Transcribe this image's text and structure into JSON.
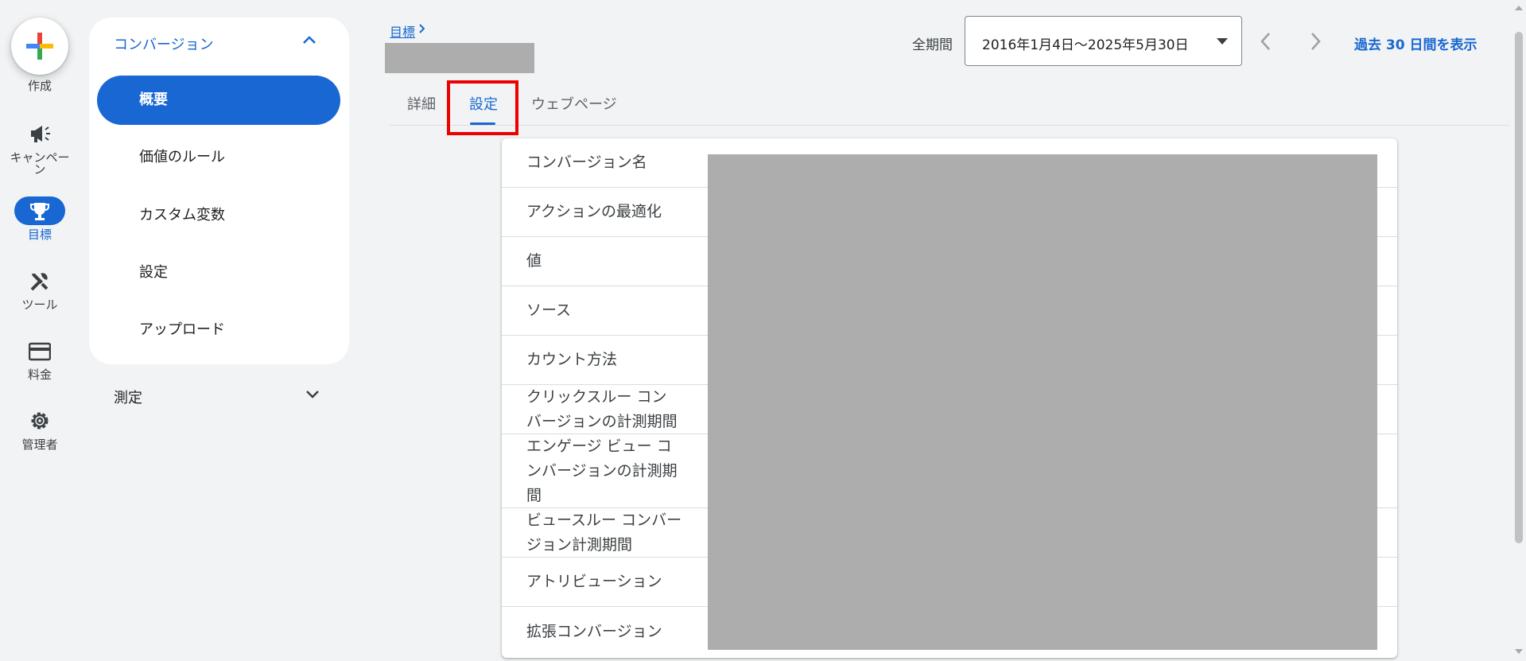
{
  "rail": {
    "create_label": "作成",
    "items": [
      {
        "label": "キャンペーン",
        "icon": "megaphone-icon"
      },
      {
        "label": "目標",
        "icon": "trophy-icon"
      },
      {
        "label": "ツール",
        "icon": "tools-icon"
      },
      {
        "label": "料金",
        "icon": "credit-card-icon"
      },
      {
        "label": "管理者",
        "icon": "gear-icon"
      }
    ]
  },
  "nav": {
    "group_title": "コンバージョン",
    "items": [
      {
        "label": "概要"
      },
      {
        "label": "価値のルール"
      },
      {
        "label": "カスタム変数"
      },
      {
        "label": "設定"
      },
      {
        "label": "アップロード"
      }
    ],
    "measure_label": "測定"
  },
  "header": {
    "breadcrumb": "目標",
    "period_label": "全期間",
    "date_range": "2016年1月4日〜2025年5月30日",
    "last30_link": "過去 30 日間を表示"
  },
  "tabs": [
    {
      "label": "詳細"
    },
    {
      "label": "設定"
    },
    {
      "label": "ウェブページ"
    }
  ],
  "settings": {
    "rows": [
      {
        "lines": [
          "コンバージョン名"
        ]
      },
      {
        "lines": [
          "アクションの最適化"
        ]
      },
      {
        "lines": [
          "値"
        ]
      },
      {
        "lines": [
          "ソース"
        ]
      },
      {
        "lines": [
          "カウント方法"
        ]
      },
      {
        "lines": [
          "クリックスルー コン",
          "バージョンの計測期間"
        ]
      },
      {
        "lines": [
          "エンゲージ ビュー コ",
          "ンバージョンの計測期",
          "間"
        ]
      },
      {
        "lines": [
          "ビュースルー コンバー",
          "ジョン計測期間"
        ]
      },
      {
        "lines": [
          "アトリビューション"
        ]
      },
      {
        "lines": [
          "拡張コンバージョン"
        ]
      }
    ]
  },
  "colors": {
    "accent": "#1967d2",
    "highlight": "#ee0000",
    "redacted": "#adadad",
    "background": "#f1f3f4"
  }
}
